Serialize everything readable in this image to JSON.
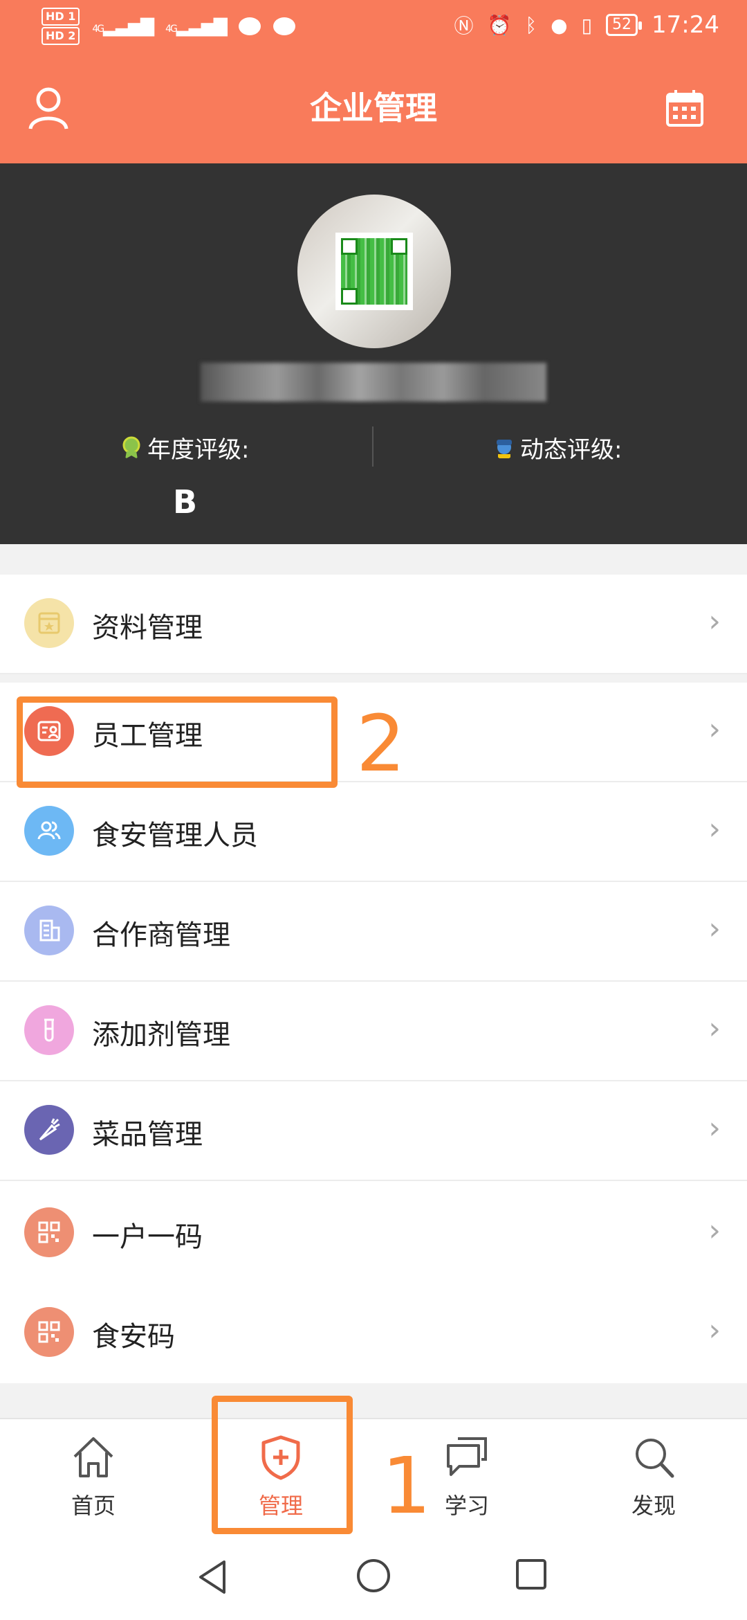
{
  "status_bar": {
    "sim": [
      "HD 1",
      "HD 2"
    ],
    "signal": [
      "4G",
      "4G"
    ],
    "battery": "52",
    "time": "17:24"
  },
  "header": {
    "title": "企业管理",
    "left_icon": "user-icon",
    "right_icon": "calendar-icon"
  },
  "profile": {
    "annual_rating_label": "年度评级:",
    "annual_rating_value": "B",
    "dynamic_rating_label": "动态评级:"
  },
  "menu": [
    {
      "label": "资料管理",
      "icon": "profile-doc-icon",
      "color": "#f5e3a8"
    },
    {
      "label": "员工管理",
      "icon": "staff-card-icon",
      "color": "#ef6b52"
    },
    {
      "label": "食安管理人员",
      "icon": "people-icon",
      "color": "#6db8f4"
    },
    {
      "label": "合作商管理",
      "icon": "building-icon",
      "color": "#a9b9f0"
    },
    {
      "label": "添加剂管理",
      "icon": "test-tube-icon",
      "color": "#f0a7de"
    },
    {
      "label": "菜品管理",
      "icon": "carrot-icon",
      "color": "#6a65b2"
    },
    {
      "label": "一户一码",
      "icon": "qr-code-icon",
      "color": "#ee8f73"
    },
    {
      "label": "食安码",
      "icon": "qr-code-icon",
      "color": "#ee8f73"
    }
  ],
  "annotations": {
    "step1": "1",
    "step2": "2"
  },
  "tabs": [
    {
      "label": "首页",
      "icon": "home-icon"
    },
    {
      "label": "管理",
      "icon": "shield-plus-icon",
      "active": true
    },
    {
      "label": "学习",
      "icon": "chat-icon"
    },
    {
      "label": "发现",
      "icon": "search-icon"
    }
  ],
  "colors": {
    "header": "#f97b5b",
    "accent": "#f06b4a",
    "annotation": "#f98a35",
    "profile_bg": "#333333"
  }
}
